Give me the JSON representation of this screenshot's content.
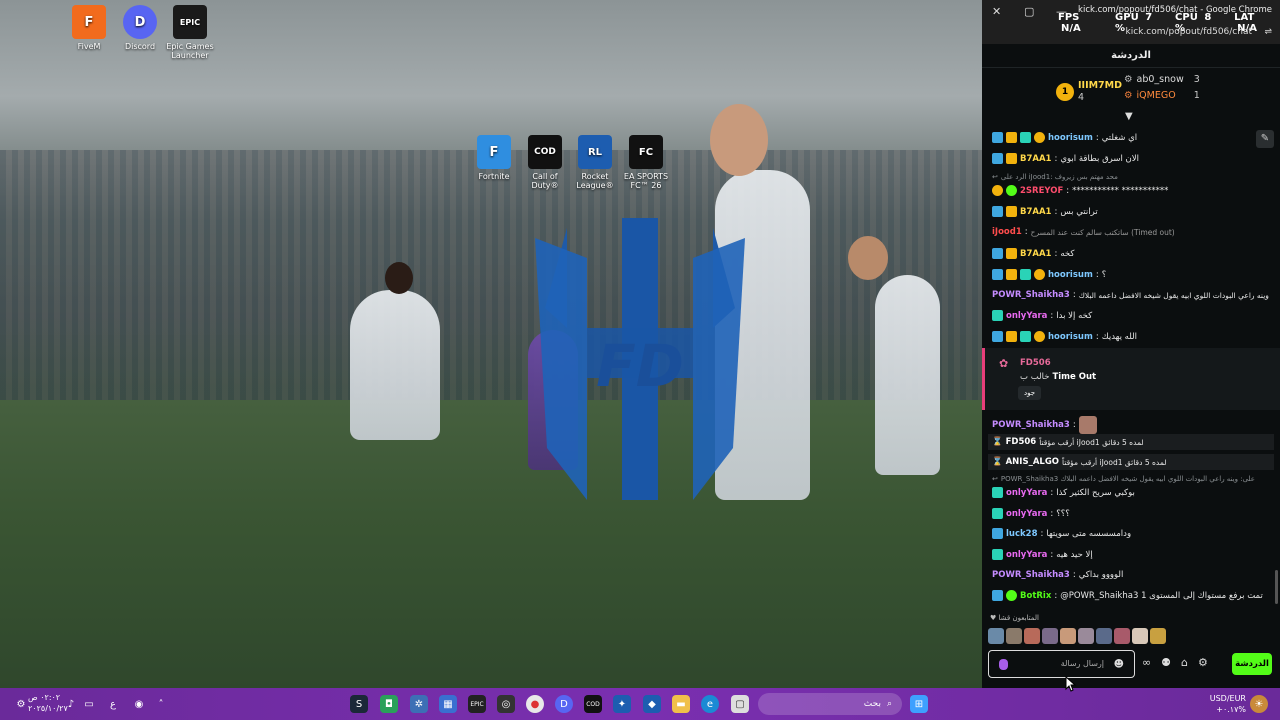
{
  "desktop": {
    "icons": [
      {
        "label": "FiveM",
        "color": "#f26b1d",
        "glyph": "F"
      },
      {
        "label": "Discord",
        "color": "#5865f2",
        "glyph": "D"
      },
      {
        "label": "Epic Games Launcher",
        "color": "#1a1a1a",
        "glyph": "EPIC"
      },
      {
        "label": "Fortnite",
        "color": "#2f8ee0",
        "glyph": "F"
      },
      {
        "label": "Call of Duty®",
        "color": "#111111",
        "glyph": "COD"
      },
      {
        "label": "Rocket League®",
        "color": "#1d5db0",
        "glyph": "RL"
      },
      {
        "label": "EA SPORTS FC™ 26",
        "color": "#111111",
        "glyph": "FC"
      }
    ]
  },
  "taskbar": {
    "time": "٠٢:٠٢ ص",
    "date": "٢٠٢٥/١٠/٢٧",
    "lang": "ع",
    "search_placeholder": "بحث",
    "currency": "USD/EUR",
    "currency_value": "+٠.١٧%"
  },
  "chat_window": {
    "window_title": "kick.com/popout/fd506/chat - Google Chrome",
    "url": "kick.com/popout/fd506/chat",
    "overlay": {
      "fps_label": "FPS",
      "fps": "N/A",
      "gpu_label": "GPU",
      "gpu": "7 %",
      "cpu_label": "CPU",
      "cpu": "8 %",
      "lat_label": "LAT",
      "lat": "N/A"
    },
    "header": "الدردشة",
    "leaders": [
      {
        "name": "IIIM7MD",
        "count": "4"
      },
      {
        "name": "ab0_snow",
        "count": "3"
      },
      {
        "name": "iQMEGO",
        "count": "1"
      }
    ],
    "messages": [
      {
        "user": "hoorisum",
        "color": "#7ec8ff",
        "text": "اي شغلتي"
      },
      {
        "user": "B7AA1",
        "color": "#ffd84a",
        "text": "الان اسرق بطاقة ابوي"
      },
      {
        "reply": "الرد على iJood1: محد مهتم بس زيروف"
      },
      {
        "user": "2SREYOF",
        "color": "#ff4d6d",
        "text": "*********** ***********"
      },
      {
        "user": "B7AA1",
        "color": "#ffd84a",
        "text": "ترانتي بس"
      },
      {
        "user": "iJood1",
        "color": "#ff4d4d",
        "text": "ساتكتب سالم كنت عند المسرح (Timed out)"
      },
      {
        "user": "B7AA1",
        "color": "#ffd84a",
        "text": "كخه"
      },
      {
        "user": "hoorisum",
        "color": "#7ec8ff",
        "text": "؟"
      },
      {
        "user": "POWR_Shaikha3",
        "color": "#c58cff",
        "text": "وينه راعي البودات اللوي ابيه يقول شيخه الافضل داعمه البلاك"
      },
      {
        "user": "onlyYara",
        "color": "#e86af0",
        "text": "كخه إلا بدا"
      },
      {
        "user": "hoorisum",
        "color": "#7ec8ff",
        "text": "الله يهديك"
      },
      {
        "user": "POWR_Shaikha3",
        "color": "#c58cff",
        "text": ""
      },
      {
        "user": "FD506",
        "color": "#ffffff",
        "text": "أرقب مؤقتاً iJood1 لمده 5 دقائق"
      },
      {
        "user": "ANIS_ALGO",
        "color": "#ffffff",
        "text": "أرقب مؤقتاً iJood1 لمده 5 دقائق"
      },
      {
        "reply": "POWR_Shaikha3 على: وينه راعي البودات اللوي ابيه يقول شيخه الافضل داعمه البلاك"
      },
      {
        "user": "onlyYara",
        "color": "#e86af0",
        "text": "بوكبي سريح الكثير كذا"
      },
      {
        "user": "onlyYara",
        "color": "#e86af0",
        "text": "؟؟؟"
      },
      {
        "user": "luck28",
        "color": "#7ec8ff",
        "text": "ودامسسسه متى سويتها"
      },
      {
        "user": "onlyYara",
        "color": "#e86af0",
        "text": "إلا حيد هيه"
      },
      {
        "user": "POWR_Shaikha3",
        "color": "#c58cff",
        "text": "الوووو بداكي"
      },
      {
        "user": "BotRix",
        "color": "#53fc18",
        "text": "@POWR_Shaikha3 تمت برفع مستواك إلى المستوى 1"
      }
    ],
    "mod_card": {
      "name": "FD506",
      "line_a": "Time Out",
      "line_b": "خالب ب",
      "button": "جود"
    },
    "supporters_label": "المتابعون قشا",
    "composer_placeholder": "إرسال رسالة",
    "send_label": "الدردشة",
    "colors": {
      "accent": "#53fc18",
      "bg": "#0b0e0f"
    }
  }
}
